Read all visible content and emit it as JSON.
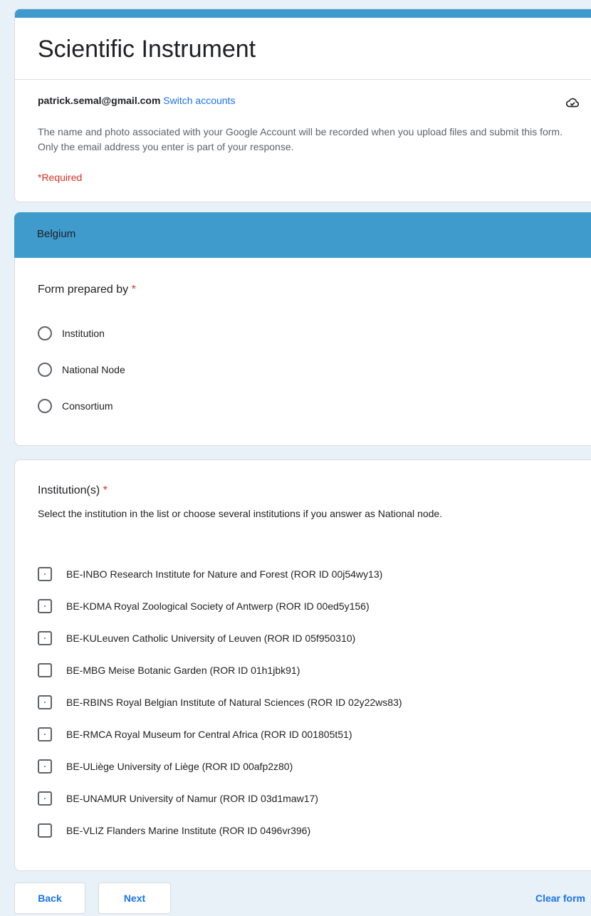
{
  "form": {
    "title": "Scientific Instrument",
    "account_email": "patrick.semal@gmail.com",
    "switch_accounts": "Switch accounts",
    "notice": "The name and photo associated with your Google Account will be recorded when you upload files and submit this form. Only the email address you enter is part of your response.",
    "required_note": "*Required"
  },
  "section": {
    "title": "Belgium"
  },
  "question1": {
    "title": "Form prepared by",
    "required_mark": "*",
    "options": [
      "Institution",
      "National Node",
      "Consortium"
    ]
  },
  "question2": {
    "title": "Institution(s)",
    "required_mark": "*",
    "description": "Select the institution in the list or choose several institutions if you answer as National node.",
    "options": [
      "BE-INBO Research Institute for Nature and Forest (ROR ID 00j54wy13)",
      "BE-KDMA Royal Zoological Society of Antwerp (ROR ID 00ed5y156)",
      "BE-KULeuven Catholic University of Leuven (ROR ID 05f950310)",
      "BE-MBG Meise Botanic Garden (ROR ID 01h1jbk91)",
      "BE-RBINS Royal Belgian Institute of Natural Sciences (ROR ID 02y22ws83)",
      "BE-RMCA Royal Museum for Central Africa (ROR ID 001805t51)",
      "BE-ULiège University of Liège (ROR ID 00afp2z80)",
      "BE-UNAMUR University of Namur (ROR ID 03d1maw17)",
      "BE-VLIZ Flanders Marine Institute (ROR ID 0496vr396)"
    ]
  },
  "footer": {
    "back_label": "Back",
    "next_label": "Next",
    "clear_label": "Clear form"
  },
  "colors": {
    "accent": "#3e9bcc",
    "link": "#1a73e8",
    "required": "#d93025",
    "background": "#e8f1f7"
  },
  "icons": {
    "cloud": "cloud-check-icon"
  }
}
